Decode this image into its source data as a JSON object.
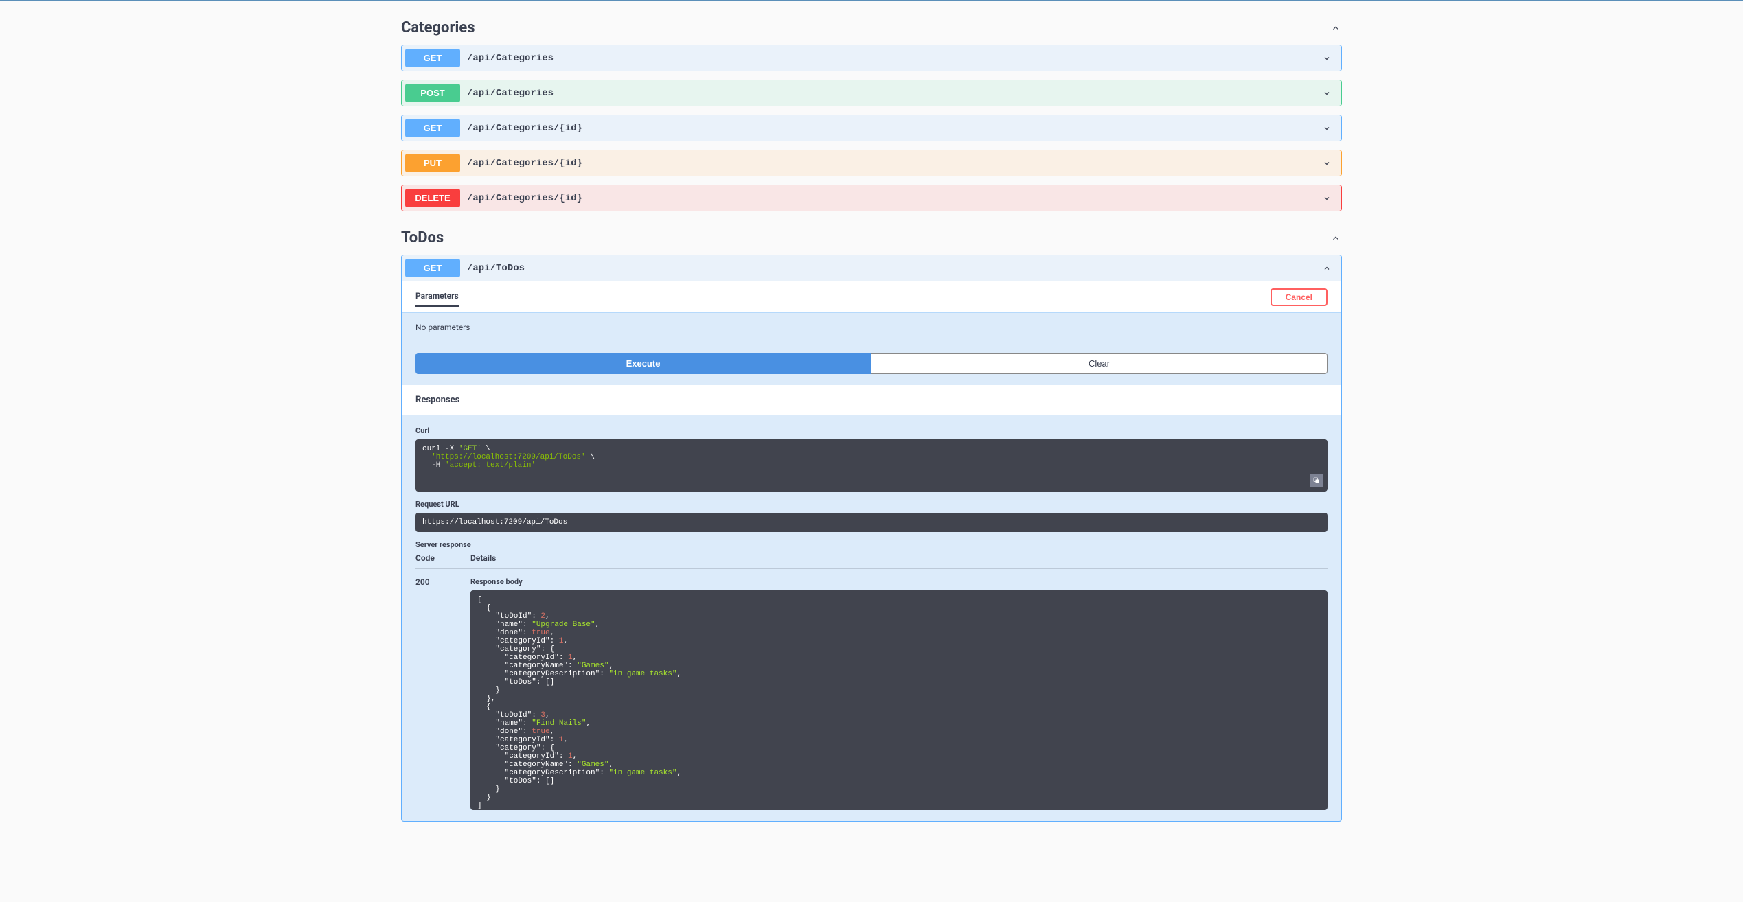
{
  "sections": [
    {
      "id": "categories",
      "title": "Categories",
      "expanded": true,
      "ops": [
        {
          "method": "GET",
          "path": "/api/Categories"
        },
        {
          "method": "POST",
          "path": "/api/Categories"
        },
        {
          "method": "GET",
          "path": "/api/Categories/{id}"
        },
        {
          "method": "PUT",
          "path": "/api/Categories/{id}"
        },
        {
          "method": "DELETE",
          "path": "/api/Categories/{id}"
        }
      ]
    },
    {
      "id": "todos",
      "title": "ToDos",
      "expanded": true,
      "ops": [
        {
          "method": "GET",
          "path": "/api/ToDos",
          "expanded": true
        }
      ]
    }
  ],
  "detail": {
    "tabs": {
      "parameters": "Parameters"
    },
    "cancel": "Cancel",
    "no_params": "No parameters",
    "execute": "Execute",
    "clear": "Clear",
    "responses_header": "Responses",
    "curl_label": "Curl",
    "curl": {
      "prefix": "curl -X ",
      "method": "'GET'",
      "cont1": " \\",
      "url": "  'https://localhost:7209/api/ToDos'",
      "cont2": " \\",
      "header_flag": "  -H ",
      "header_val": "'accept: text/plain'"
    },
    "request_url_label": "Request URL",
    "request_url": "https://localhost:7209/api/ToDos",
    "server_response_label": "Server response",
    "col_code": "Code",
    "col_details": "Details",
    "status_code": "200",
    "response_body_label": "Response body",
    "response_json": [
      {
        "toDoId": 2,
        "name": "Upgrade Base",
        "done": true,
        "categoryId": 1,
        "category": {
          "categoryId": 1,
          "categoryName": "Games",
          "categoryDescription": "in game tasks",
          "toDos": []
        }
      },
      {
        "toDoId": 3,
        "name": "Find Nails",
        "done": true,
        "categoryId": 1,
        "category": {
          "categoryId": 1,
          "categoryName": "Games",
          "categoryDescription": "in game tasks",
          "toDos": []
        }
      }
    ]
  }
}
